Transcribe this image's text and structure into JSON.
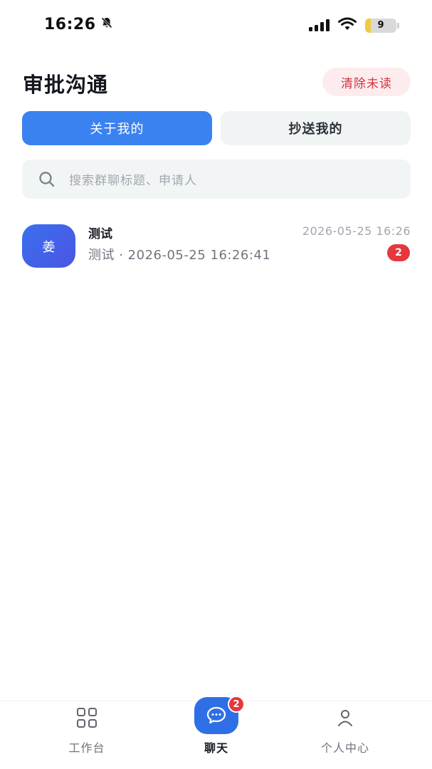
{
  "status_bar": {
    "time": "16:26",
    "battery": "9",
    "icons": [
      "bell-muted-icon",
      "cellular-signal-icon",
      "wifi-icon",
      "battery-icon"
    ]
  },
  "header": {
    "title": "审批沟通",
    "clear_unread": "清除未读"
  },
  "tabs": [
    {
      "label": "关于我的",
      "active": true
    },
    {
      "label": "抄送我的",
      "active": false
    }
  ],
  "search": {
    "placeholder": "搜索群聊标题、申请人",
    "icon": "search-icon"
  },
  "conversations": [
    {
      "avatar_text": "姜",
      "title": "测试",
      "time": "2026-05-25 16:26",
      "preview": "测试 · 2026-05-25 16:26:41",
      "unread": "2"
    }
  ],
  "bottom_nav": {
    "items": [
      {
        "label": "工作台",
        "icon": "grid-icon",
        "active": false
      },
      {
        "label": "聊天",
        "icon": "chat-bubble-icon",
        "active": true,
        "badge": "2"
      },
      {
        "label": "个人中心",
        "icon": "person-icon",
        "active": false
      }
    ]
  },
  "colors": {
    "primary": "#3a82f0",
    "chat_button": "#2f6fe6",
    "badge": "#e5383e",
    "clear_button_bg": "#fdecee",
    "clear_button_text": "#d2353f"
  }
}
